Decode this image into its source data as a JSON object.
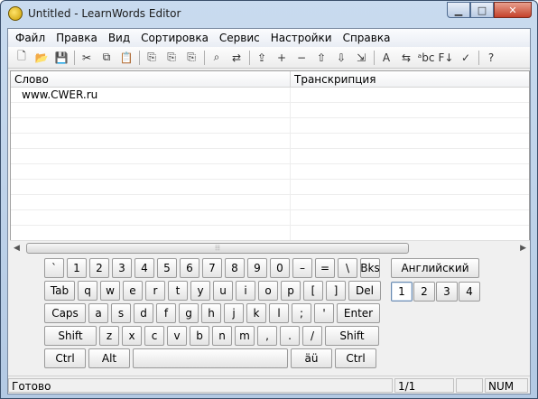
{
  "window": {
    "title": "Untitled - LearnWords Editor",
    "minimize": "▁",
    "maximize": "□",
    "close": "✕"
  },
  "menu": [
    "Файл",
    "Правка",
    "Вид",
    "Сортировка",
    "Сервис",
    "Настройки",
    "Справка"
  ],
  "toolbar": [
    "new-doc-icon",
    "open-folder-icon",
    "save-icon",
    "|",
    "cut-icon",
    "copy-icon",
    "paste-icon",
    "|",
    "insert-row-icon",
    "insert-rows-icon",
    "insert-multi-icon",
    "|",
    "find-icon",
    "replace-icon",
    "|",
    "import-icon",
    "add-icon",
    "remove-icon",
    "move-up-icon",
    "move-down-icon",
    "export-icon",
    "|",
    "font-icon",
    "swap-icon",
    "abc-icon",
    "sort-icon",
    "check-icon",
    "|",
    "help-icon"
  ],
  "toolbar_glyphs": {
    "new-doc-icon": "🗋",
    "open-folder-icon": "📂",
    "save-icon": "💾",
    "cut-icon": "✂",
    "copy-icon": "⧉",
    "paste-icon": "📋",
    "insert-row-icon": "⎘",
    "insert-rows-icon": "⎘",
    "insert-multi-icon": "⎘",
    "find-icon": "⌕",
    "replace-icon": "⇄",
    "import-icon": "⇪",
    "add-icon": "+",
    "remove-icon": "−",
    "move-up-icon": "⇧",
    "move-down-icon": "⇩",
    "export-icon": "⇲",
    "font-icon": "A",
    "swap-icon": "⇆",
    "abc-icon": "ᵃbc",
    "sort-icon": "F↓",
    "check-icon": "✓",
    "help-icon": "?"
  },
  "grid": {
    "columns": [
      "Слово",
      "Транскрипция"
    ],
    "rows": [
      [
        "www.CWER.ru",
        ""
      ],
      [
        "",
        ""
      ],
      [
        "",
        ""
      ],
      [
        "",
        ""
      ],
      [
        "",
        ""
      ],
      [
        "",
        ""
      ],
      [
        "",
        ""
      ],
      [
        "",
        ""
      ],
      [
        "",
        ""
      ],
      [
        "",
        ""
      ]
    ]
  },
  "keyboard": {
    "rows": [
      [
        "`",
        "1",
        "2",
        "3",
        "4",
        "5",
        "6",
        "7",
        "8",
        "9",
        "0",
        "–",
        "=",
        "\\",
        "Bks"
      ],
      [
        "Tab",
        "q",
        "w",
        "e",
        "r",
        "t",
        "y",
        "u",
        "i",
        "o",
        "p",
        "[",
        "]",
        "Del"
      ],
      [
        "Caps",
        "a",
        "s",
        "d",
        "f",
        "g",
        "h",
        "j",
        "k",
        "l",
        ";",
        "'",
        "Enter"
      ],
      [
        "Shift",
        "z",
        "x",
        "c",
        "v",
        "b",
        "n",
        "m",
        ",",
        ".",
        "/",
        "Shift"
      ],
      [
        "Ctrl",
        "Alt",
        "",
        "äü",
        "Ctrl"
      ]
    ],
    "language": "Английский",
    "number_keys": [
      "1",
      "2",
      "3",
      "4"
    ],
    "selected_number": "1"
  },
  "status": {
    "text": "Готово",
    "position": "1/1",
    "num": "NUM"
  }
}
